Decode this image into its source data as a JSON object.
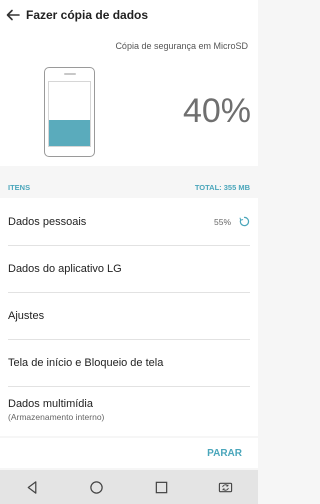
{
  "header": {
    "title": "Fazer cópia de dados"
  },
  "hero": {
    "location": "Cópia de segurança em MicroSD",
    "percent": "40%",
    "progress_fraction": 0.4
  },
  "section": {
    "left": "ITENS",
    "right": "TOTAL: 355 MB"
  },
  "items": [
    {
      "label": "Dados pessoais",
      "status": "55%"
    },
    {
      "label": "Dados do aplicativo LG"
    },
    {
      "label": "Ajustes"
    },
    {
      "label": "Tela de início e Bloqueio de tela"
    },
    {
      "label": "Dados multimídia",
      "sub": "(Armazenamento interno)"
    }
  ],
  "actions": {
    "stop": "PARAR"
  },
  "colors": {
    "accent": "#4aa6bb",
    "fill": "#5aabbc"
  },
  "icons": {
    "back": "arrow-left-icon",
    "spinner": "sync-spinner-icon",
    "nav": [
      "back-triangle-icon",
      "home-circle-icon",
      "overview-square-icon",
      "switch-app-icon"
    ]
  }
}
